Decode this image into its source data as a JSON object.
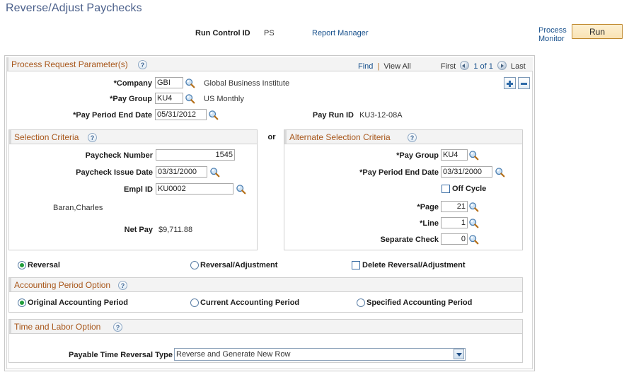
{
  "page": {
    "title": "Reverse/Adjust Paychecks"
  },
  "header": {
    "run_control_label": "Run Control ID",
    "run_control_value": "PS",
    "report_manager_link": "Report Manager",
    "process_monitor_link": "Process Monitor",
    "run_button": "Run"
  },
  "process_request": {
    "band_title": "Process Request Parameter(s)",
    "help": "?",
    "find_link": "Find",
    "separator": "|",
    "view_all_link": "View All",
    "first_link": "First",
    "count": "1 of 1",
    "last_link": "Last",
    "add_row": "+",
    "delete_row": "-",
    "company_label": "*Company",
    "company_value": "GBI",
    "company_desc": "Global Business Institute",
    "pay_group_label": "*Pay Group",
    "pay_group_value": "KU4",
    "pay_group_desc": "US Monthly",
    "pay_period_end_label": "*Pay Period End Date",
    "pay_period_end_value": "05/31/2012",
    "pay_run_id_label": "Pay Run ID",
    "pay_run_id_value": "KU3-12-08A"
  },
  "selection_criteria": {
    "band_title": "Selection Criteria",
    "help": "?",
    "or_text": "or",
    "paycheck_number_label": "Paycheck Number",
    "paycheck_number_value": "1545",
    "paycheck_issue_date_label": "Paycheck Issue Date",
    "paycheck_issue_date_value": "03/31/2000",
    "empl_id_label": "Empl ID",
    "empl_id_value": "KU0002",
    "employee_name": "Baran,Charles",
    "net_pay_label": "Net Pay",
    "net_pay_value": "$9,711.88"
  },
  "alternate_selection_criteria": {
    "band_title": "Alternate Selection Criteria",
    "help": "?",
    "pay_group_label": "*Pay Group",
    "pay_group_value": "KU4",
    "pay_period_end_label": "*Pay Period End Date",
    "pay_period_end_value": "03/31/2000",
    "off_cycle_label": "Off Cycle",
    "page_label": "*Page",
    "page_value": "21",
    "line_label": "*Line",
    "line_value": "1",
    "separate_check_label": "Separate Check",
    "separate_check_value": "0"
  },
  "action_options": {
    "reversal_label": "Reversal",
    "reversal_adjustment_label": "Reversal/Adjustment",
    "delete_reversal_adjustment_label": "Delete Reversal/Adjustment",
    "selected": "Reversal"
  },
  "accounting_period_option": {
    "band_title": "Accounting Period Option",
    "help": "?",
    "options": [
      "Original Accounting Period",
      "Current Accounting Period",
      "Specified Accounting Period"
    ],
    "selected": "Original Accounting Period"
  },
  "time_and_labor_option": {
    "band_title": "Time and Labor Option",
    "help": "?",
    "payable_time_label": "Payable Time Reversal Type",
    "payable_time_value": "Reverse and Generate New Row",
    "payable_time_options": [
      "Reverse and Generate New Row"
    ]
  },
  "colors": {
    "title_blue": "#4a5f8a",
    "band_orange": "#a8571b",
    "link_blue": "#17508c",
    "run_button_bg": "#f9e3b4",
    "run_button_border": "#c08a30",
    "radio_on_green": "#1f9c3a"
  }
}
